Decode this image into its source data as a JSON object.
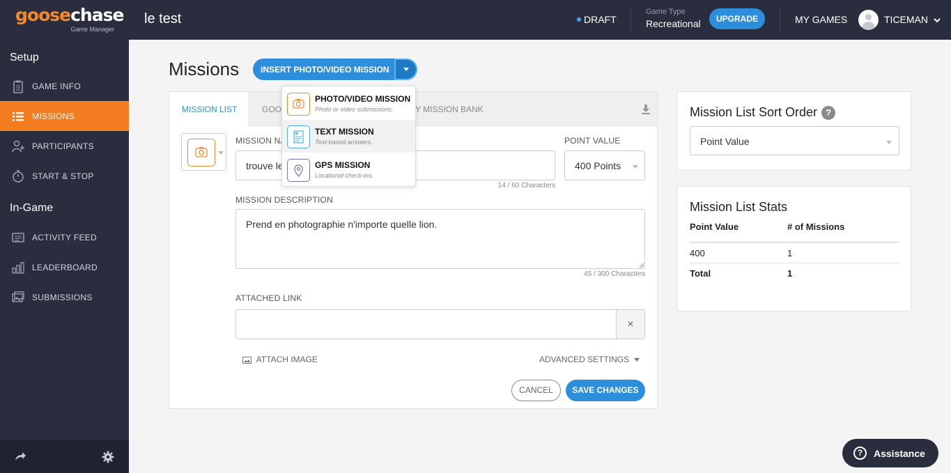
{
  "topbar": {
    "logo_goose": "goose",
    "logo_chase": "chase",
    "logo_sub": "Game Manager",
    "game_title": "le test",
    "status": "DRAFT",
    "game_type_label": "Game Type",
    "game_type_value": "Recreational",
    "upgrade_label": "UPGRADE",
    "my_games_label": "MY GAMES",
    "username": "TICEMAN"
  },
  "sidebar": {
    "setup_label": "Setup",
    "ingame_label": "In-Game",
    "setup_items": [
      {
        "label": "GAME INFO",
        "icon": "clipboard-icon"
      },
      {
        "label": "MISSIONS",
        "icon": "list-icon",
        "active": true
      },
      {
        "label": "PARTICIPANTS",
        "icon": "add-user-icon"
      },
      {
        "label": "START & STOP",
        "icon": "stopwatch-icon"
      }
    ],
    "ingame_items": [
      {
        "label": "ACTIVITY FEED",
        "icon": "feed-icon"
      },
      {
        "label": "LEADERBOARD",
        "icon": "bar-chart-icon"
      },
      {
        "label": "SUBMISSIONS",
        "icon": "images-icon"
      }
    ]
  },
  "main": {
    "title": "Missions",
    "insert_button_label": "INSERT PHOTO/VIDEO MISSION",
    "tabs": [
      "MISSION LIST",
      "GOO",
      "Y MISSION BANK"
    ],
    "mission_name_label": "MISSION NA",
    "mission_name_value": "trouve le",
    "mission_name_counter": "14 / 60 Characters",
    "point_value_label": "POINT VALUE",
    "point_value": "400 Points",
    "description_label": "MISSION DESCRIPTION",
    "description_value": "Prend en photographie n'importe quelle lion.",
    "description_counter": "45 / 300 Characters",
    "attached_link_label": "ATTACHED LINK",
    "attached_link_value": "",
    "clear_link": "×",
    "attach_image_label": "ATTACH IMAGE",
    "advanced_settings_label": "ADVANCED SETTINGS",
    "cancel_label": "CANCEL",
    "save_label": "SAVE CHANGES"
  },
  "dropdown": {
    "items": [
      {
        "title": "PHOTO/VIDEO MISSION",
        "desc": "Photo or video submissions.",
        "icon": "camera-icon",
        "color": "#f4892a"
      },
      {
        "title": "TEXT MISSION",
        "desc": "Text-based answers.",
        "icon": "document-icon",
        "color": "#4ab0e0"
      },
      {
        "title": "GPS MISSION",
        "desc": "Locational check-ins.",
        "icon": "location-pin-icon",
        "color": "#7a6fb0"
      }
    ]
  },
  "sort_card": {
    "title": "Mission List Sort Order",
    "help": "?",
    "selected": "Point Value"
  },
  "stats_card": {
    "title": "Mission List Stats",
    "headers": [
      "Point Value",
      "# of Missions"
    ],
    "rows": [
      [
        "400",
        "1"
      ]
    ],
    "total_label": "Total",
    "total_value": "1"
  },
  "assistance": {
    "icon": "?",
    "label": "Assistance"
  },
  "colors": {
    "navy": "#2a2d3e",
    "orange": "#f37d20",
    "blue": "#2d8fdc"
  }
}
